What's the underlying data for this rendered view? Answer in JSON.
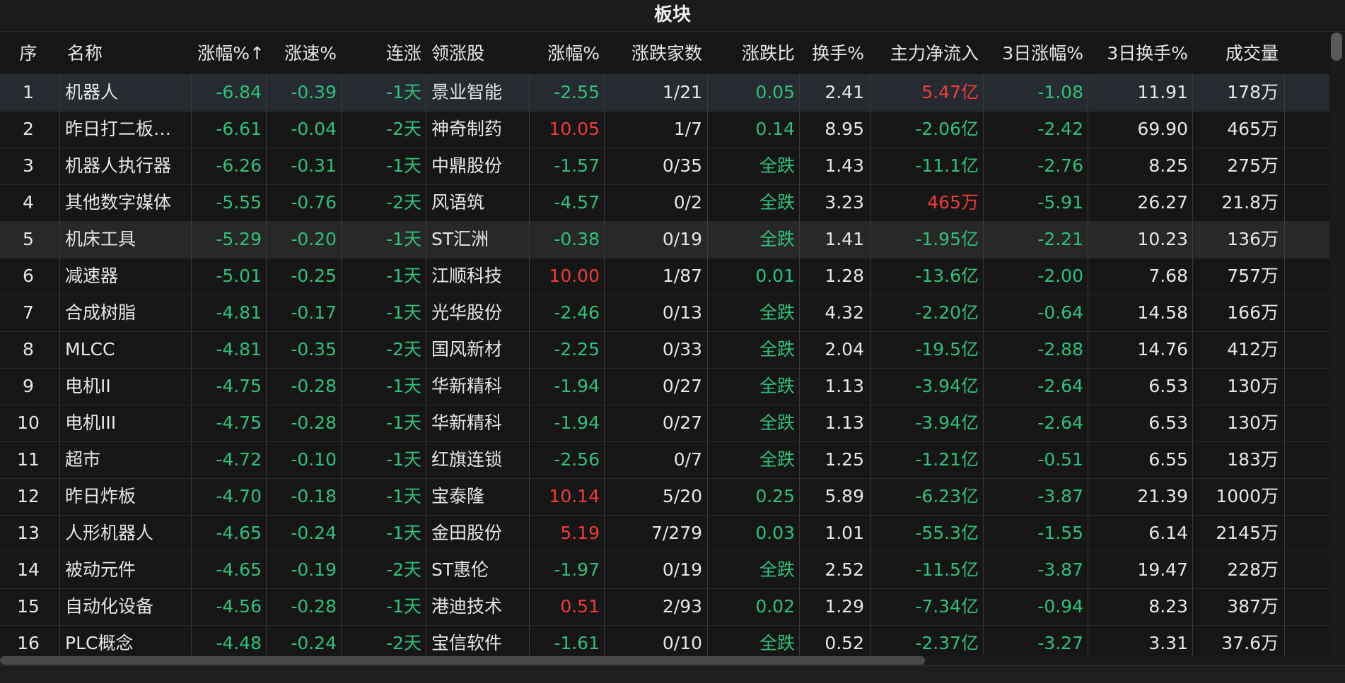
{
  "title": "板块",
  "colors": {
    "up": "#f03a3a",
    "down": "#2fc07a",
    "text": "#e6e6e6",
    "bg": "#161616",
    "selected_row": "#262a31"
  },
  "columns": [
    {
      "key": "idx",
      "label": "序"
    },
    {
      "key": "name",
      "label": "名称"
    },
    {
      "key": "chg",
      "label": "涨幅%↑"
    },
    {
      "key": "speed",
      "label": "涨速%"
    },
    {
      "key": "streak",
      "label": "连涨"
    },
    {
      "key": "leader",
      "label": "领涨股"
    },
    {
      "key": "lchg",
      "label": "涨幅%"
    },
    {
      "key": "updown",
      "label": "涨跌家数"
    },
    {
      "key": "ratio",
      "label": "涨跌比"
    },
    {
      "key": "turnover",
      "label": "换手%"
    },
    {
      "key": "inflow",
      "label": "主力净流入"
    },
    {
      "key": "chg3",
      "label": "3日涨幅%"
    },
    {
      "key": "turn3",
      "label": "3日换手%"
    },
    {
      "key": "volume",
      "label": "成交量"
    }
  ],
  "rows": [
    {
      "idx": "1",
      "name": "机器人",
      "chg": "-6.84",
      "speed": "-0.39",
      "streak": "-1天",
      "leader": "景业智能",
      "lchg": "-2.55",
      "updown": "1/21",
      "ratio": "0.05",
      "turnover": "2.41",
      "inflow": "5.47亿",
      "chg3": "-1.08",
      "turn3": "11.91",
      "volume": "178万"
    },
    {
      "idx": "2",
      "name": "昨日打二板…",
      "chg": "-6.61",
      "speed": "-0.04",
      "streak": "-2天",
      "leader": "神奇制药",
      "lchg": "10.05",
      "updown": "1/7",
      "ratio": "0.14",
      "turnover": "8.95",
      "inflow": "-2.06亿",
      "chg3": "-2.42",
      "turn3": "69.90",
      "volume": "465万"
    },
    {
      "idx": "3",
      "name": "机器人执行器",
      "chg": "-6.26",
      "speed": "-0.31",
      "streak": "-1天",
      "leader": "中鼎股份",
      "lchg": "-1.57",
      "updown": "0/35",
      "ratio": "全跌",
      "turnover": "1.43",
      "inflow": "-11.1亿",
      "chg3": "-2.76",
      "turn3": "8.25",
      "volume": "275万"
    },
    {
      "idx": "4",
      "name": "其他数字媒体",
      "chg": "-5.55",
      "speed": "-0.76",
      "streak": "-2天",
      "leader": "风语筑",
      "lchg": "-4.57",
      "updown": "0/2",
      "ratio": "全跌",
      "turnover": "3.23",
      "inflow": "465万",
      "chg3": "-5.91",
      "turn3": "26.27",
      "volume": "21.8万"
    },
    {
      "idx": "5",
      "name": "机床工具",
      "chg": "-5.29",
      "speed": "-0.20",
      "streak": "-1天",
      "leader": "ST汇洲",
      "lchg": "-0.38",
      "updown": "0/19",
      "ratio": "全跌",
      "turnover": "1.41",
      "inflow": "-1.95亿",
      "chg3": "-2.21",
      "turn3": "10.23",
      "volume": "136万"
    },
    {
      "idx": "6",
      "name": "减速器",
      "chg": "-5.01",
      "speed": "-0.25",
      "streak": "-1天",
      "leader": "江顺科技",
      "lchg": "10.00",
      "updown": "1/87",
      "ratio": "0.01",
      "turnover": "1.28",
      "inflow": "-13.6亿",
      "chg3": "-2.00",
      "turn3": "7.68",
      "volume": "757万"
    },
    {
      "idx": "7",
      "name": "合成树脂",
      "chg": "-4.81",
      "speed": "-0.17",
      "streak": "-1天",
      "leader": "光华股份",
      "lchg": "-2.46",
      "updown": "0/13",
      "ratio": "全跌",
      "turnover": "4.32",
      "inflow": "-2.20亿",
      "chg3": "-0.64",
      "turn3": "14.58",
      "volume": "166万"
    },
    {
      "idx": "8",
      "name": "MLCC",
      "chg": "-4.81",
      "speed": "-0.35",
      "streak": "-2天",
      "leader": "国风新材",
      "lchg": "-2.25",
      "updown": "0/33",
      "ratio": "全跌",
      "turnover": "2.04",
      "inflow": "-19.5亿",
      "chg3": "-2.88",
      "turn3": "14.76",
      "volume": "412万"
    },
    {
      "idx": "9",
      "name": "电机II",
      "chg": "-4.75",
      "speed": "-0.28",
      "streak": "-1天",
      "leader": "华新精科",
      "lchg": "-1.94",
      "updown": "0/27",
      "ratio": "全跌",
      "turnover": "1.13",
      "inflow": "-3.94亿",
      "chg3": "-2.64",
      "turn3": "6.53",
      "volume": "130万"
    },
    {
      "idx": "10",
      "name": "电机III",
      "chg": "-4.75",
      "speed": "-0.28",
      "streak": "-1天",
      "leader": "华新精科",
      "lchg": "-1.94",
      "updown": "0/27",
      "ratio": "全跌",
      "turnover": "1.13",
      "inflow": "-3.94亿",
      "chg3": "-2.64",
      "turn3": "6.53",
      "volume": "130万"
    },
    {
      "idx": "11",
      "name": "超市",
      "chg": "-4.72",
      "speed": "-0.10",
      "streak": "-1天",
      "leader": "红旗连锁",
      "lchg": "-2.56",
      "updown": "0/7",
      "ratio": "全跌",
      "turnover": "1.25",
      "inflow": "-1.21亿",
      "chg3": "-0.51",
      "turn3": "6.55",
      "volume": "183万"
    },
    {
      "idx": "12",
      "name": "昨日炸板",
      "chg": "-4.70",
      "speed": "-0.18",
      "streak": "-1天",
      "leader": "宝泰隆",
      "lchg": "10.14",
      "updown": "5/20",
      "ratio": "0.25",
      "turnover": "5.89",
      "inflow": "-6.23亿",
      "chg3": "-3.87",
      "turn3": "21.39",
      "volume": "1000万"
    },
    {
      "idx": "13",
      "name": "人形机器人",
      "chg": "-4.65",
      "speed": "-0.24",
      "streak": "-1天",
      "leader": "金田股份",
      "lchg": "5.19",
      "updown": "7/279",
      "ratio": "0.03",
      "turnover": "1.01",
      "inflow": "-55.3亿",
      "chg3": "-1.55",
      "turn3": "6.14",
      "volume": "2145万"
    },
    {
      "idx": "14",
      "name": "被动元件",
      "chg": "-4.65",
      "speed": "-0.19",
      "streak": "-2天",
      "leader": "ST惠伦",
      "lchg": "-1.97",
      "updown": "0/19",
      "ratio": "全跌",
      "turnover": "2.52",
      "inflow": "-11.5亿",
      "chg3": "-3.87",
      "turn3": "19.47",
      "volume": "228万"
    },
    {
      "idx": "15",
      "name": "自动化设备",
      "chg": "-4.56",
      "speed": "-0.28",
      "streak": "-1天",
      "leader": "港迪技术",
      "lchg": "0.51",
      "updown": "2/93",
      "ratio": "0.02",
      "turnover": "1.29",
      "inflow": "-7.34亿",
      "chg3": "-0.94",
      "turn3": "8.23",
      "volume": "387万"
    },
    {
      "idx": "16",
      "name": "PLC概念",
      "chg": "-4.48",
      "speed": "-0.24",
      "streak": "-2天",
      "leader": "宝信软件",
      "lchg": "-1.61",
      "updown": "0/10",
      "ratio": "全跌",
      "turnover": "0.52",
      "inflow": "-2.37亿",
      "chg3": "-3.27",
      "turn3": "3.31",
      "volume": "37.6万"
    }
  ]
}
